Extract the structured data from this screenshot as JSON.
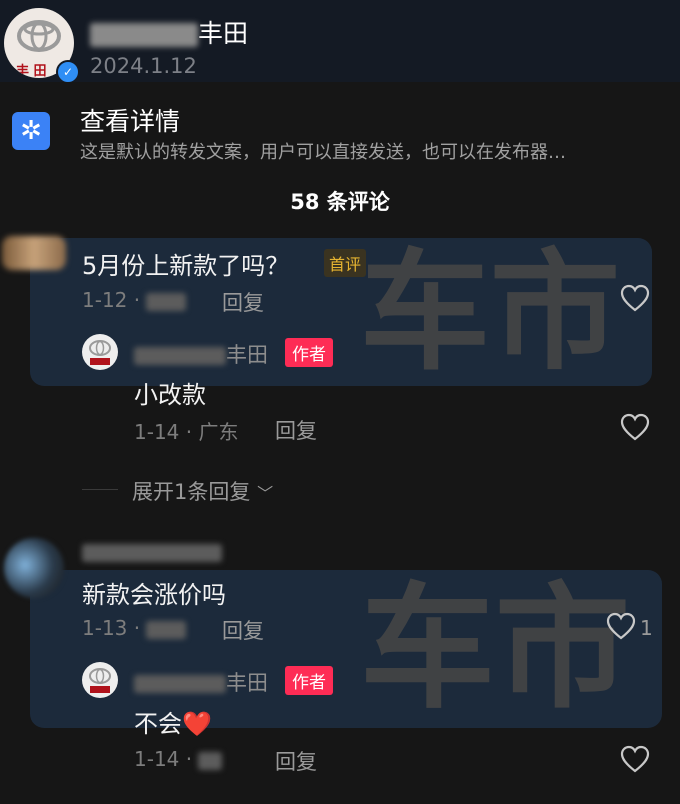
{
  "account": {
    "name_suffix": "丰田",
    "date": "2024.1.12",
    "avatar_text": "丰 田"
  },
  "share": {
    "title": "查看详情",
    "desc": "这是默认的转发文案，用户可以直接发送，也可以在发布器…"
  },
  "comments_header": "58 条评论",
  "watermark": "车市",
  "comments": [
    {
      "text": "5月份上新款了吗？",
      "badge": "首评",
      "date": "1-12 ·",
      "reply_label": "回复",
      "like_count": "",
      "replies": [
        {
          "name_suffix": "丰田",
          "badge": "作者",
          "text": "小改款",
          "date": "1-14 · 广东",
          "reply_label": "回复"
        }
      ],
      "expand_label": "展开1条回复"
    },
    {
      "text": "新款会涨价吗",
      "date": "1-13 ·",
      "reply_label": "回复",
      "like_count": "1",
      "replies": [
        {
          "name_suffix": "丰田",
          "badge": "作者",
          "text": "不会",
          "emoji": "❤️",
          "date": "1-14 ·",
          "reply_label": "回复"
        }
      ]
    }
  ],
  "colors": {
    "author_badge": "#fe2c55",
    "first_badge": "#e6b431",
    "share_icon": "#3b82f6",
    "verified": "#2f8ef5"
  }
}
